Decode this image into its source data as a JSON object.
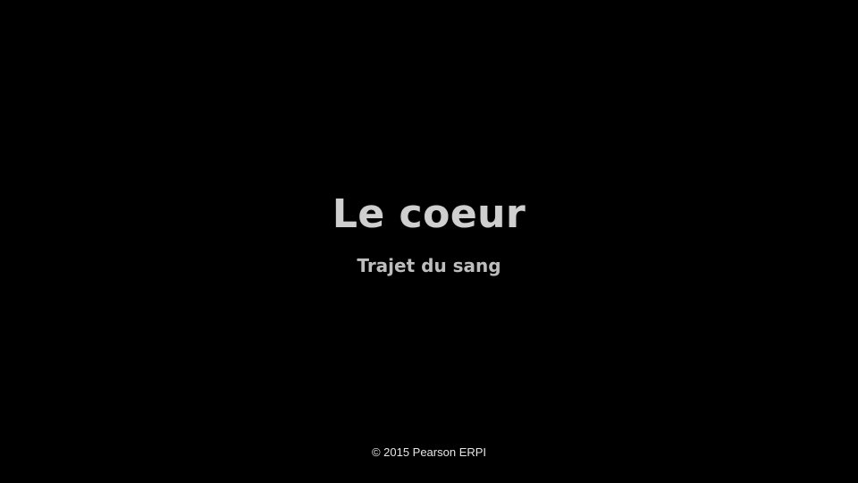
{
  "slide": {
    "title": "Le coeur",
    "subtitle": "Trajet du sang",
    "copyright": "© 2015 Pearson ERPI"
  },
  "colors": {
    "background": "#000000",
    "title": "#cfcfcf",
    "subtitle": "#bdbdbd",
    "copyright": "#e6e6e6"
  }
}
